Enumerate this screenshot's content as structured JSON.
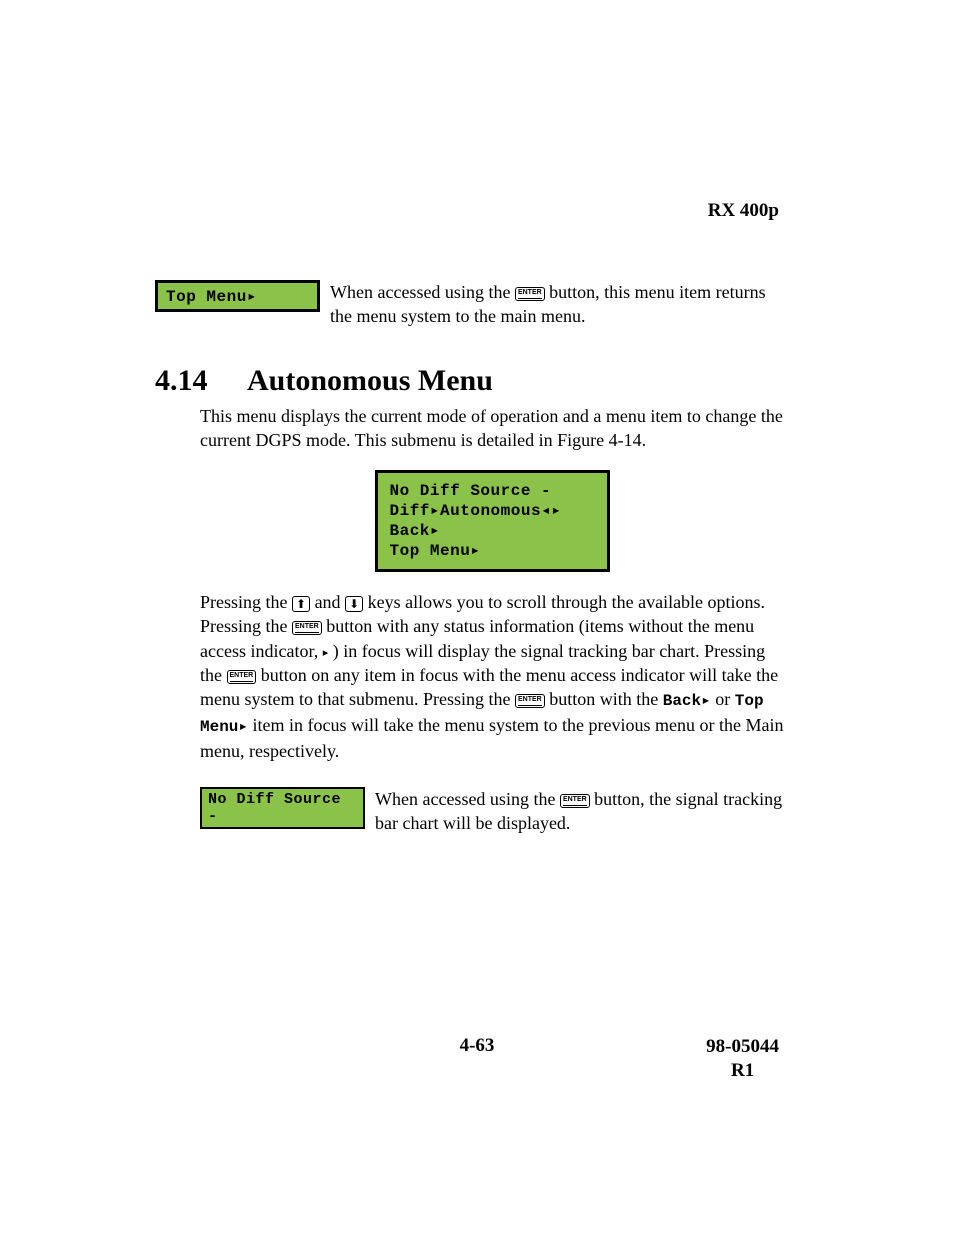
{
  "header": {
    "model": "RX 400p"
  },
  "top_menu_row": {
    "lcd_label": "Top Menu▸",
    "desc_1": "When accessed using the ",
    "desc_2": " button, this menu item returns the menu system to the main menu."
  },
  "heading": {
    "number": "4.14",
    "title": "Autonomous Menu"
  },
  "intro": "This menu displays the current mode of operation and a menu item to change the current DGPS mode.  This submenu is detailed in Figure 4-14.",
  "lcd_screen": {
    "line1": "No Diff Source -",
    "line2": "Diff▸Autonomous◂▸",
    "line3": "Back▸",
    "line4": "Top Menu▸"
  },
  "body": {
    "p1a": "Pressing the ",
    "p1b": " and ",
    "p1c": " keys allows you to scroll through the available options. Pressing the ",
    "p1d": " button with any status information (items without the menu access indicator, ",
    "p1e": " ) in focus will display the signal tracking bar chart.  Pressing the ",
    "p1f": " button on any item in focus with the menu access indicator will take the menu system to that submenu. Pressing the ",
    "p1g": " button with the ",
    "inline_back": "Back▸",
    "p1h": " or ",
    "inline_top": "Top Menu▸",
    "p1i": " item in focus will take the menu system to the previous menu or the Main menu, respectively.",
    "tri": "▸"
  },
  "no_diff_row": {
    "lcd_label": "No Diff Source -",
    "desc_1": "When accessed using the ",
    "desc_2": " button, the signal tracking bar chart will be displayed."
  },
  "enter_label": "ENTER",
  "footer": {
    "page": "4-63",
    "doc": "98-05044",
    "rev": "R1"
  }
}
